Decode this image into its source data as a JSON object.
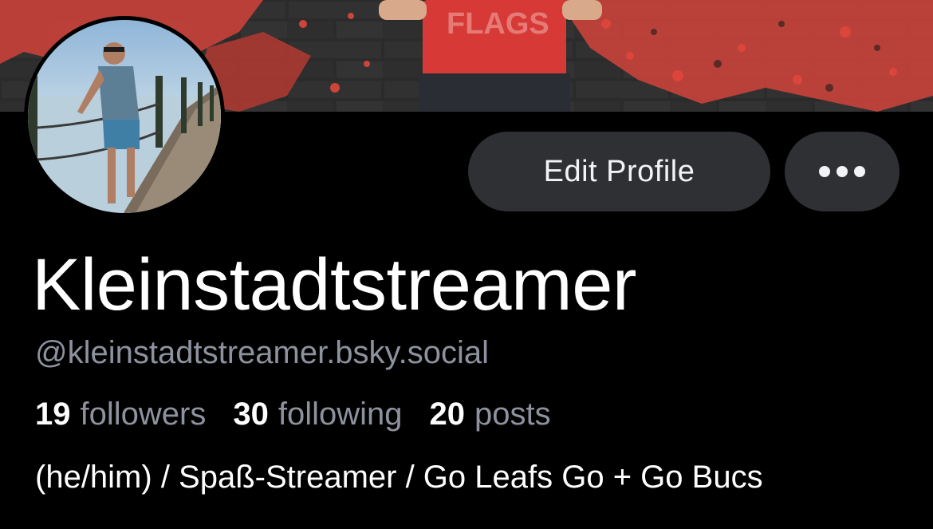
{
  "profile": {
    "display_name": "Kleinstadtstreamer",
    "handle": "@kleinstadtstreamer.bsky.social",
    "bio": "(he/him) / Spaß-Streamer / Go Leafs Go + Go Bucs"
  },
  "stats": {
    "followers_count": "19",
    "followers_label": "followers",
    "following_count": "30",
    "following_label": "following",
    "posts_count": "20",
    "posts_label": "posts"
  },
  "actions": {
    "edit_profile_label": "Edit Profile",
    "more_icon": "ellipsis-icon"
  },
  "banner": {
    "shirt_text": "FLAGS"
  },
  "colors": {
    "background": "#000000",
    "button_bg": "#2e3034",
    "muted_text": "#8d929e",
    "banner_red": "#e0463c"
  }
}
